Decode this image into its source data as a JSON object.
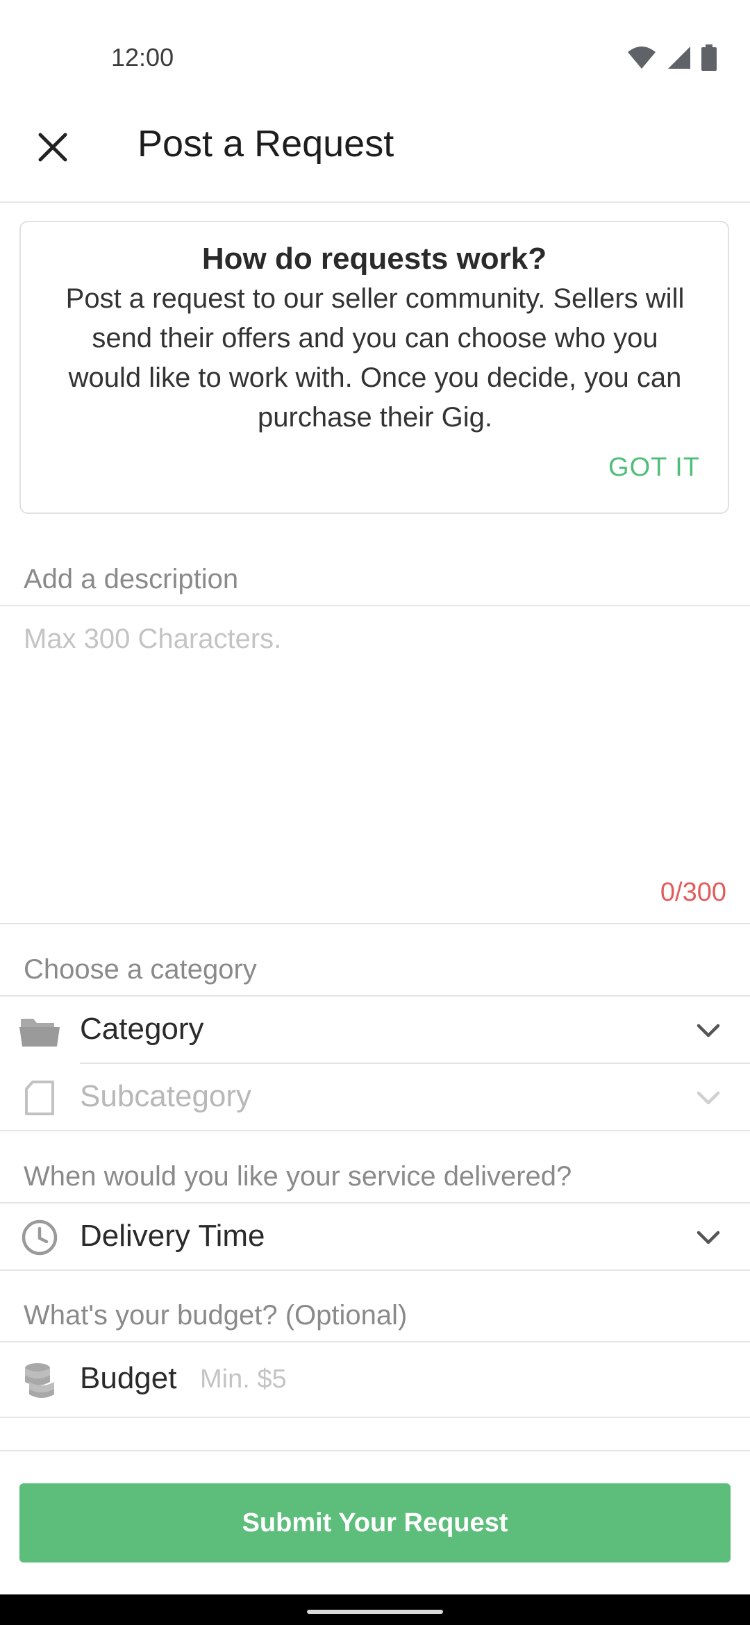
{
  "status_bar": {
    "time": "12:00",
    "icons": [
      "wifi-icon",
      "cellular-signal-icon",
      "battery-icon"
    ]
  },
  "app_bar": {
    "close_icon": "close-icon",
    "title": "Post a Request"
  },
  "info_card": {
    "title": "How do requests work?",
    "text": "Post a request to our seller community. Sellers will send their offers and you can choose who you would like to work with. Once you decide, you can purchase their Gig.",
    "action": "GOT IT"
  },
  "description": {
    "label": "Add a description",
    "placeholder": "Max 300 Characters.",
    "counter": "0/300"
  },
  "category": {
    "label": "Choose a category",
    "category_field": {
      "icon": "folder-icon",
      "label": "Category"
    },
    "subcategory_field": {
      "icon": "document-icon",
      "label": "Subcategory"
    }
  },
  "delivery": {
    "label": "When would you like your service delivered?",
    "field": {
      "icon": "clock-icon",
      "label": "Delivery Time"
    }
  },
  "budget": {
    "label": "What's your budget? (Optional)",
    "field_icon": "coins-icon",
    "field_label": "Budget",
    "placeholder": "Min. $5"
  },
  "submit": {
    "label": "Submit Your Request"
  },
  "colors": {
    "accent": "#5cbe7a",
    "accent_text": "#4fbe79",
    "counter": "#e25c5c"
  }
}
